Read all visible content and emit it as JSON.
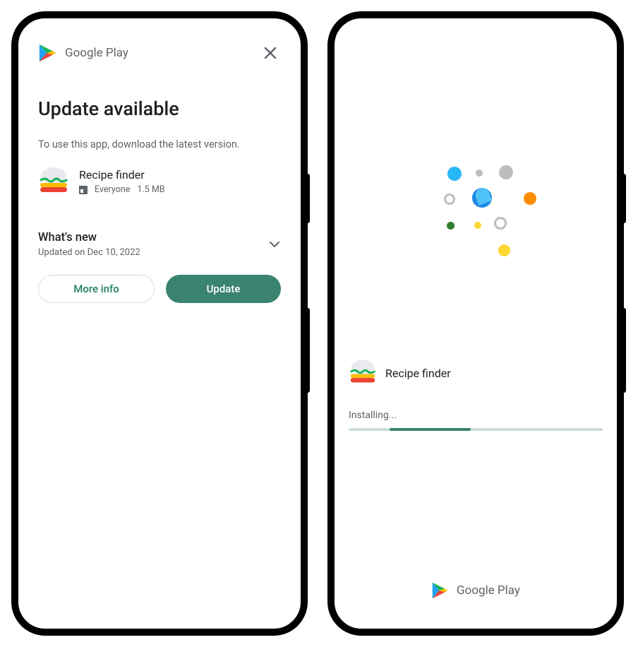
{
  "brand": "Google Play",
  "screen1": {
    "title": "Update available",
    "subtitle": "To use this app, download the latest version.",
    "app": {
      "name": "Recipe finder",
      "rating_label": "Everyone",
      "size": "1.5 MB"
    },
    "whatsnew": {
      "title": "What's new",
      "updated": "Updated on Dec 10, 2022"
    },
    "buttons": {
      "more_info": "More info",
      "update": "Update"
    }
  },
  "screen2": {
    "app_name": "Recipe finder",
    "status": "Installing...",
    "progress": {
      "offset_pct": 16,
      "width_pct": 32
    },
    "footer_brand": "Google Play"
  },
  "colors": {
    "primary": "#3a8370",
    "gray": "#5f6368",
    "track": "#c8e0d7"
  }
}
